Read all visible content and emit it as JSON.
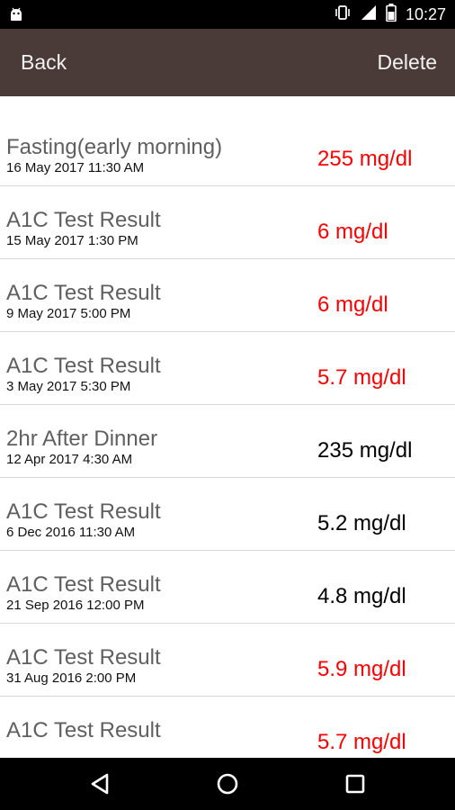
{
  "status_bar": {
    "time": "10:27",
    "icons": [
      "android-icon",
      "vibrate-icon",
      "signal-icon",
      "battery-icon"
    ]
  },
  "header": {
    "back_label": "Back",
    "delete_label": "Delete",
    "background_color": "#4a3b38"
  },
  "colors": {
    "high": "#ff0000",
    "normal": "#000000"
  },
  "entries": [
    {
      "title": "Fasting(early morning)",
      "date": "16 May 2017 11:30 AM",
      "value": "255 mg/dl",
      "color": "#ff0000"
    },
    {
      "title": "A1C Test Result",
      "date": "15 May 2017 1:30 PM",
      "value": "6 mg/dl",
      "color": "#ff0000"
    },
    {
      "title": "A1C Test Result",
      "date": "9 May 2017 5:00 PM",
      "value": "6 mg/dl",
      "color": "#ff0000"
    },
    {
      "title": "A1C Test Result",
      "date": "3 May 2017 5:30 PM",
      "value": "5.7 mg/dl",
      "color": "#ff0000"
    },
    {
      "title": "2hr After Dinner",
      "date": "12 Apr 2017 4:30 AM",
      "value": "235 mg/dl",
      "color": "#000000"
    },
    {
      "title": "A1C Test Result",
      "date": "6 Dec 2016 11:30 AM",
      "value": "5.2 mg/dl",
      "color": "#000000"
    },
    {
      "title": "A1C Test Result",
      "date": "21 Sep 2016 12:00 PM",
      "value": "4.8 mg/dl",
      "color": "#000000"
    },
    {
      "title": "A1C Test Result",
      "date": "31 Aug 2016 2:00 PM",
      "value": "5.9 mg/dl",
      "color": "#ff0000"
    },
    {
      "title": "A1C Test Result",
      "date": "",
      "value": "5.7 mg/dl",
      "color": "#ff0000"
    }
  ],
  "nav_bar": {
    "icons": [
      "nav-back-icon",
      "nav-home-icon",
      "nav-recents-icon"
    ]
  }
}
